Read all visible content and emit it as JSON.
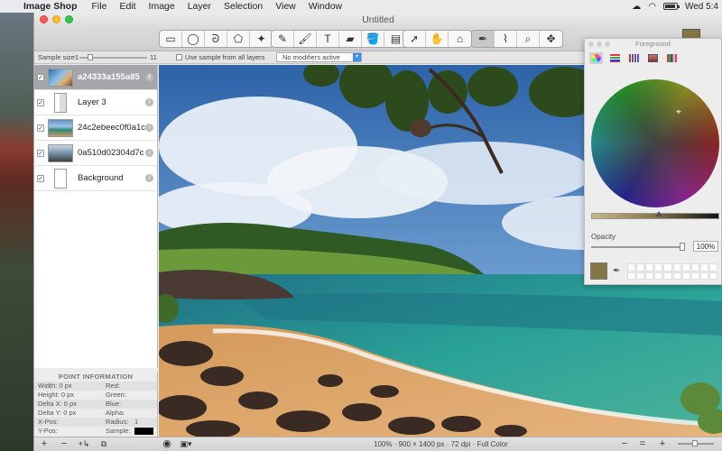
{
  "menubar": {
    "apple": "",
    "app_name": "Image Shop",
    "items": [
      "File",
      "Edit",
      "Image",
      "Layer",
      "Selection",
      "View",
      "Window"
    ],
    "clock": "Wed 5:4"
  },
  "window": {
    "title": "Untitled"
  },
  "tools": [
    {
      "name": "rect-select-icon",
      "glyph": "▭"
    },
    {
      "name": "ellipse-select-icon",
      "glyph": "◯"
    },
    {
      "name": "lasso-icon",
      "glyph": "ᘐ"
    },
    {
      "name": "polygon-lasso-icon",
      "glyph": "⬠"
    },
    {
      "name": "magic-wand-icon",
      "glyph": "✦"
    },
    {
      "name": "pencil-icon",
      "glyph": "✎"
    },
    {
      "name": "brush-icon",
      "glyph": "🖌"
    },
    {
      "name": "text-icon",
      "glyph": "T"
    },
    {
      "name": "eraser-icon",
      "glyph": "▰"
    },
    {
      "name": "paint-bucket-icon",
      "glyph": "🪣"
    },
    {
      "name": "gradient-icon",
      "glyph": "▤"
    },
    {
      "name": "move-arrow-icon",
      "glyph": "➚"
    },
    {
      "name": "hand-icon",
      "glyph": "✋"
    },
    {
      "name": "stamp-icon",
      "glyph": "⌂"
    },
    {
      "name": "eyedropper-icon",
      "glyph": "✒"
    },
    {
      "name": "smudge-icon",
      "glyph": "⌇"
    },
    {
      "name": "zoom-icon",
      "glyph": "⌕"
    },
    {
      "name": "pan-icon",
      "glyph": "✥"
    }
  ],
  "options": {
    "sample_label": "Sample size:",
    "sample_min": "1",
    "sample_max": "11",
    "sample_value_fraction": 0.12,
    "use_all_layers_label": "Use sample from all layers",
    "modifier_select": "No modifiers active"
  },
  "layers": [
    {
      "name": "a24333a155a85",
      "thumb": "photo",
      "selected": true,
      "visible": true
    },
    {
      "name": "Layer 3",
      "thumb": "stripe",
      "selected": false,
      "visible": true
    },
    {
      "name": "24c2ebeec0f0a1c",
      "thumb": "beach",
      "selected": false,
      "visible": true
    },
    {
      "name": "0a510d02304d7c",
      "thumb": "wide",
      "selected": false,
      "visible": true
    },
    {
      "name": "Background",
      "thumb": "white",
      "selected": false,
      "visible": true
    }
  ],
  "point_info": {
    "title": "POINT INFORMATION",
    "width": "Width:  0 px",
    "height": "Height:  0 px",
    "delta_x": "Delta X: 0 px",
    "delta_y": "Delta Y: 0 px",
    "x_pos": "X-Pos:",
    "y_pos": "Y-Pos:",
    "red": "Red:",
    "green": "Green:",
    "blue": "Blue:",
    "alpha": "Alpha:",
    "radius": "Radius:",
    "radius_value": "1",
    "sample": "Sample:"
  },
  "statusbar": {
    "info": "100% · 900 × 1400 px · 72 dpi · Full Color",
    "add": "+",
    "remove": "−",
    "add_group": "+↳",
    "merge": "⧉",
    "minus": "−",
    "equals": "=",
    "plus": "+"
  },
  "foreground_panel": {
    "title": "Foreground",
    "opacity_label": "Opacity",
    "opacity_value": "100%",
    "color": "#857547",
    "brightness_fraction": 0.52
  },
  "colors": {
    "accent": "#3d8ff5",
    "foreground": "#857547",
    "selected_layer": "#a5a6a9"
  }
}
